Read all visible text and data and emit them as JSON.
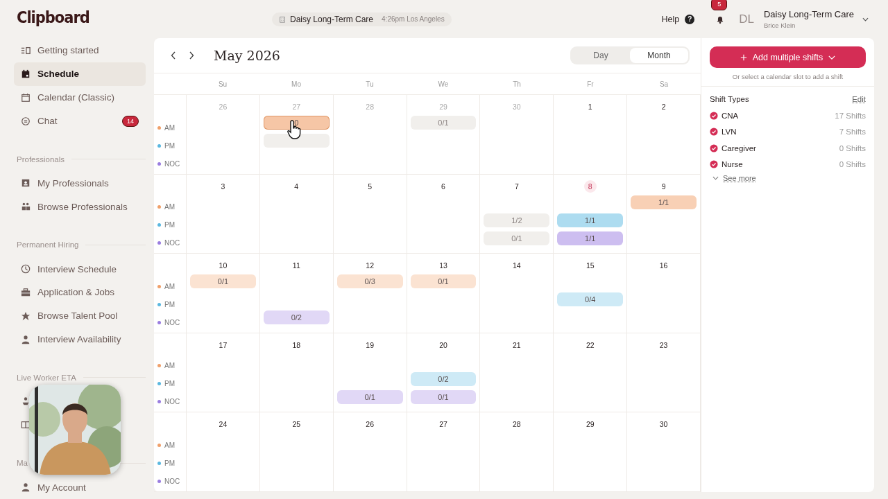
{
  "logo": "Clipboard",
  "sidebar": {
    "items": [
      {
        "kind": "item",
        "label": "Getting started",
        "selected": false
      },
      {
        "kind": "item",
        "label": "Schedule",
        "selected": true
      },
      {
        "kind": "item",
        "label": "Calendar (Classic)",
        "selected": false
      },
      {
        "kind": "item",
        "label": "Chat",
        "selected": false,
        "badge": "14"
      },
      {
        "kind": "section",
        "label": "Professionals"
      },
      {
        "kind": "item",
        "label": "My Professionals",
        "selected": false
      },
      {
        "kind": "item",
        "label": "Browse Professionals",
        "selected": false
      },
      {
        "kind": "section",
        "label": "Permanent Hiring"
      },
      {
        "kind": "item",
        "label": "Interview Schedule",
        "selected": false
      },
      {
        "kind": "item",
        "label": "Application & Jobs",
        "selected": false
      },
      {
        "kind": "item",
        "label": "Browse Talent Pool",
        "selected": false
      },
      {
        "kind": "item",
        "label": "Interview Availability",
        "selected": false
      },
      {
        "kind": "section",
        "label": "Live Worker ETA"
      },
      {
        "kind": "covered"
      },
      {
        "kind": "covered"
      },
      {
        "kind": "section",
        "label": "Ma"
      },
      {
        "kind": "item",
        "label": "My Account",
        "selected": false
      }
    ]
  },
  "topbar": {
    "facility": "Daisy Long-Term Care",
    "time": "4:26pm Los Angeles",
    "help": "Help",
    "help_icon": "?",
    "notifications": "5",
    "initials": "DL",
    "account": "Daisy Long-Term Care",
    "user": "Brice Klein"
  },
  "calendar": {
    "title": "May 2026",
    "views": [
      {
        "label": "Day",
        "selected": false
      },
      {
        "label": "Month",
        "selected": true
      }
    ],
    "weekdays": [
      "Su",
      "Mo",
      "Tu",
      "We",
      "Th",
      "Fr",
      "Sa"
    ],
    "weeks": [
      {
        "slots": [
          {
            "label": "AM",
            "color": "#f0a06a"
          },
          {
            "label": "PM",
            "color": "#5bb8e0"
          },
          {
            "label": "NOC",
            "color": "#9a7de0"
          }
        ],
        "days": [
          {
            "day": "26",
            "muted": true,
            "today": false
          },
          {
            "day": "27",
            "muted": true,
            "today": false,
            "am": {
              "kind": "open",
              "label": "0",
              "hovered": true
            },
            "pm": {
              "kind": "past"
            }
          },
          {
            "day": "28",
            "muted": true,
            "today": false
          },
          {
            "day": "29",
            "muted": true,
            "today": false,
            "am": {
              "kind": "past",
              "label": "0/1"
            }
          },
          {
            "day": "30",
            "muted": true,
            "today": false
          },
          {
            "day": "1",
            "muted": false,
            "today": false
          },
          {
            "day": "2",
            "muted": false,
            "today": false
          }
        ]
      },
      {
        "slots": [
          {
            "label": "AM",
            "color": "#f0a06a"
          },
          {
            "label": "PM",
            "color": "#5bb8e0"
          },
          {
            "label": "NOC",
            "color": "#9a7de0"
          }
        ],
        "days": [
          {
            "day": "3",
            "muted": false,
            "today": false
          },
          {
            "day": "4",
            "muted": false,
            "today": false
          },
          {
            "day": "5",
            "muted": false,
            "today": false
          },
          {
            "day": "6",
            "muted": false,
            "today": false
          },
          {
            "day": "7",
            "muted": false,
            "today": false,
            "pm": {
              "kind": "past",
              "label": "1/2"
            },
            "noc": {
              "kind": "past",
              "label": "0/1"
            }
          },
          {
            "day": "8",
            "muted": false,
            "today": true,
            "pm": {
              "kind": "filled",
              "label": "1/1"
            },
            "noc": {
              "kind": "filled",
              "label": "1/1"
            }
          },
          {
            "day": "9",
            "muted": false,
            "today": false,
            "am": {
              "kind": "filled",
              "label": "1/1"
            }
          }
        ]
      },
      {
        "slots": [
          {
            "label": "AM",
            "color": "#f0a06a"
          },
          {
            "label": "PM",
            "color": "#5bb8e0"
          },
          {
            "label": "NOC",
            "color": "#9a7de0"
          }
        ],
        "days": [
          {
            "day": "10",
            "muted": false,
            "today": false,
            "am": {
              "kind": "open",
              "label": "0/1"
            }
          },
          {
            "day": "11",
            "muted": false,
            "today": false,
            "noc": {
              "kind": "open",
              "label": "0/2"
            }
          },
          {
            "day": "12",
            "muted": false,
            "today": false,
            "am": {
              "kind": "open",
              "label": "0/3"
            }
          },
          {
            "day": "13",
            "muted": false,
            "today": false,
            "am": {
              "kind": "open",
              "label": "0/1"
            }
          },
          {
            "day": "14",
            "muted": false,
            "today": false
          },
          {
            "day": "15",
            "muted": false,
            "today": false,
            "pm": {
              "kind": "open",
              "label": "0/4"
            }
          },
          {
            "day": "16",
            "muted": false,
            "today": false
          }
        ]
      },
      {
        "slots": [
          {
            "label": "AM",
            "color": "#f0a06a"
          },
          {
            "label": "PM",
            "color": "#5bb8e0"
          },
          {
            "label": "NOC",
            "color": "#9a7de0"
          }
        ],
        "days": [
          {
            "day": "17",
            "muted": false,
            "today": false
          },
          {
            "day": "18",
            "muted": false,
            "today": false
          },
          {
            "day": "19",
            "muted": false,
            "today": false,
            "noc": {
              "kind": "open",
              "label": "0/1"
            }
          },
          {
            "day": "20",
            "muted": false,
            "today": false,
            "pm": {
              "kind": "open",
              "label": "0/2"
            },
            "noc": {
              "kind": "open",
              "label": "0/1"
            }
          },
          {
            "day": "21",
            "muted": false,
            "today": false
          },
          {
            "day": "22",
            "muted": false,
            "today": false
          },
          {
            "day": "23",
            "muted": false,
            "today": false
          }
        ]
      },
      {
        "slots": [
          {
            "label": "AM",
            "color": "#f0a06a"
          },
          {
            "label": "PM",
            "color": "#5bb8e0"
          },
          {
            "label": "NOC",
            "color": "#9a7de0"
          }
        ],
        "days": [
          {
            "day": "24",
            "muted": false,
            "today": false
          },
          {
            "day": "25",
            "muted": false,
            "today": false
          },
          {
            "day": "26",
            "muted": false,
            "today": false
          },
          {
            "day": "27",
            "muted": false,
            "today": false
          },
          {
            "day": "28",
            "muted": false,
            "today": false
          },
          {
            "day": "29",
            "muted": false,
            "today": false
          },
          {
            "day": "30",
            "muted": false,
            "today": false
          }
        ]
      }
    ]
  },
  "panel": {
    "add_button": "Add multiple shifts",
    "hint": "Or select a calendar slot to add a shift",
    "shift_types_title": "Shift Types",
    "edit": "Edit",
    "shift_types": [
      {
        "name": "CNA",
        "count": "17 Shifts",
        "checked": true
      },
      {
        "name": "LVN",
        "count": "7 Shifts",
        "checked": true
      },
      {
        "name": "Caregiver",
        "count": "0 Shifts",
        "checked": true
      },
      {
        "name": "Nurse",
        "count": "0 Shifts",
        "checked": true
      }
    ],
    "see_more": "See more"
  }
}
